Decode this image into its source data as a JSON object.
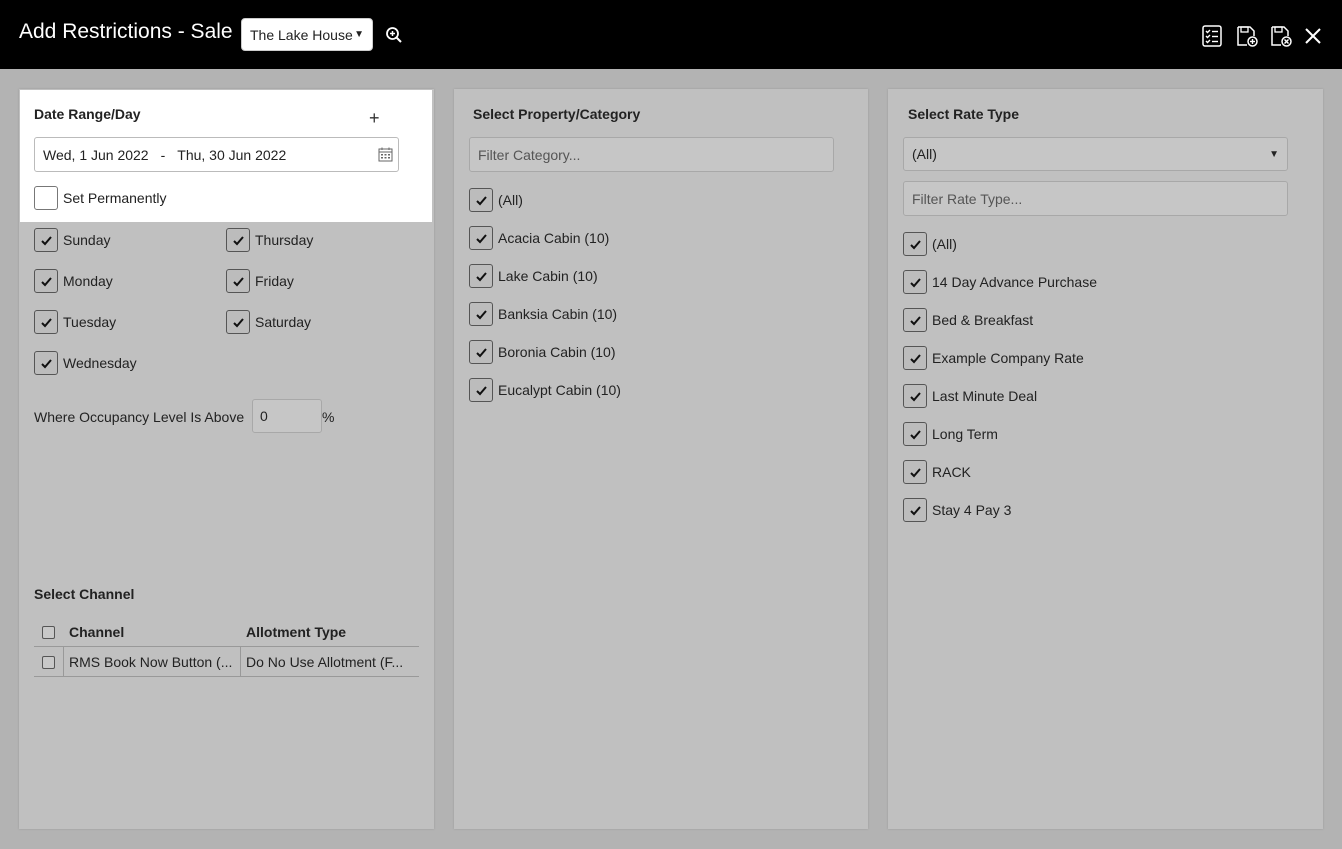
{
  "header": {
    "title": "Add Restrictions - Sale",
    "property": "The Lake House"
  },
  "date_panel": {
    "heading": "Date Range/Day",
    "add_symbol": "+",
    "date_from": "Wed, 1 Jun 2022",
    "date_separator": "-",
    "date_to": "Thu, 30 Jun 2022",
    "set_permanently": "Set Permanently",
    "days": {
      "sunday": "Sunday",
      "monday": "Monday",
      "tuesday": "Tuesday",
      "wednesday": "Wednesday",
      "thursday": "Thursday",
      "friday": "Friday",
      "saturday": "Saturday"
    },
    "occupancy_label": "Where Occupancy Level Is Above",
    "occupancy_value": "0",
    "occupancy_unit": "%"
  },
  "channel": {
    "heading": "Select Channel",
    "col_channel": "Channel",
    "col_allotment": "Allotment Type",
    "row_channel": "RMS Book Now Button (...",
    "row_allotment": "Do No Use Allotment (F..."
  },
  "category_panel": {
    "heading": "Select Property/Category",
    "filter_placeholder": "Filter Category...",
    "items": [
      "(All)",
      "Acacia Cabin (10)",
      "Lake Cabin (10)",
      "Banksia Cabin (10)",
      "Boronia Cabin (10)",
      "Eucalypt Cabin (10)"
    ]
  },
  "rate_panel": {
    "heading": "Select Rate Type",
    "select_value": "(All)",
    "filter_placeholder": "Filter Rate Type...",
    "items": [
      "(All)",
      "14 Day Advance Purchase",
      "Bed & Breakfast",
      "Example Company Rate",
      "Last Minute Deal",
      "Long Term",
      "RACK",
      "Stay 4 Pay 3"
    ]
  },
  "icons": {
    "zoom": "zoom-in-icon",
    "checklist": "checklist-icon",
    "save_new": "save-new-icon",
    "save_close": "save-close-icon",
    "close": "close-icon",
    "calendar": "calendar-icon",
    "check": "check-icon"
  },
  "colors": {
    "header_bg": "#000000",
    "panel_bg": "#c0c0c0",
    "page_bg": "#b3b3b3"
  }
}
